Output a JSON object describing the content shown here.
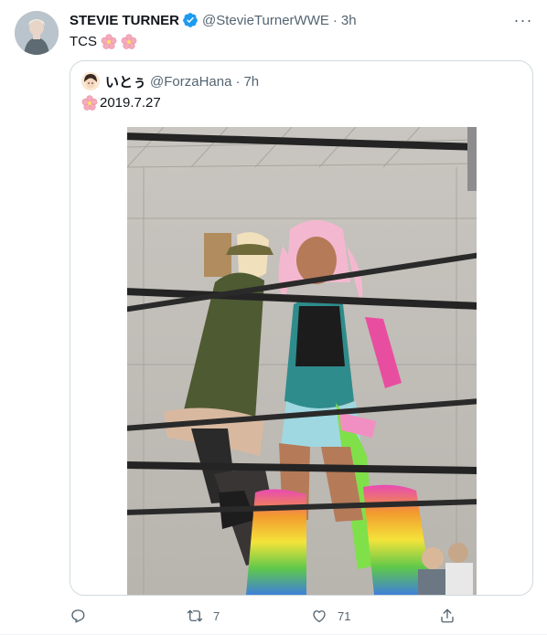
{
  "tweet": {
    "author_name": "STEVIE TURNER",
    "author_handle": "@StevieTurnerWWE",
    "separator": "·",
    "time": "3h",
    "more_label": "···",
    "text": "TCS"
  },
  "quoted_tweet": {
    "author_name": "いとぅ",
    "author_handle": "@ForzaHana",
    "separator": "·",
    "time": "7h",
    "text": "2019.7.27"
  },
  "actions": {
    "reply_count": "",
    "retweet_count": "7",
    "like_count": "71"
  },
  "colors": {
    "verified": "#1d9bf0",
    "secondary_text": "#536471",
    "border": "#cfd9de",
    "flower": "#f4abba"
  },
  "icons": [
    "verified-badge-icon",
    "cherry-blossom-icon",
    "reply-icon",
    "retweet-icon",
    "like-icon",
    "share-icon",
    "more-icon"
  ]
}
